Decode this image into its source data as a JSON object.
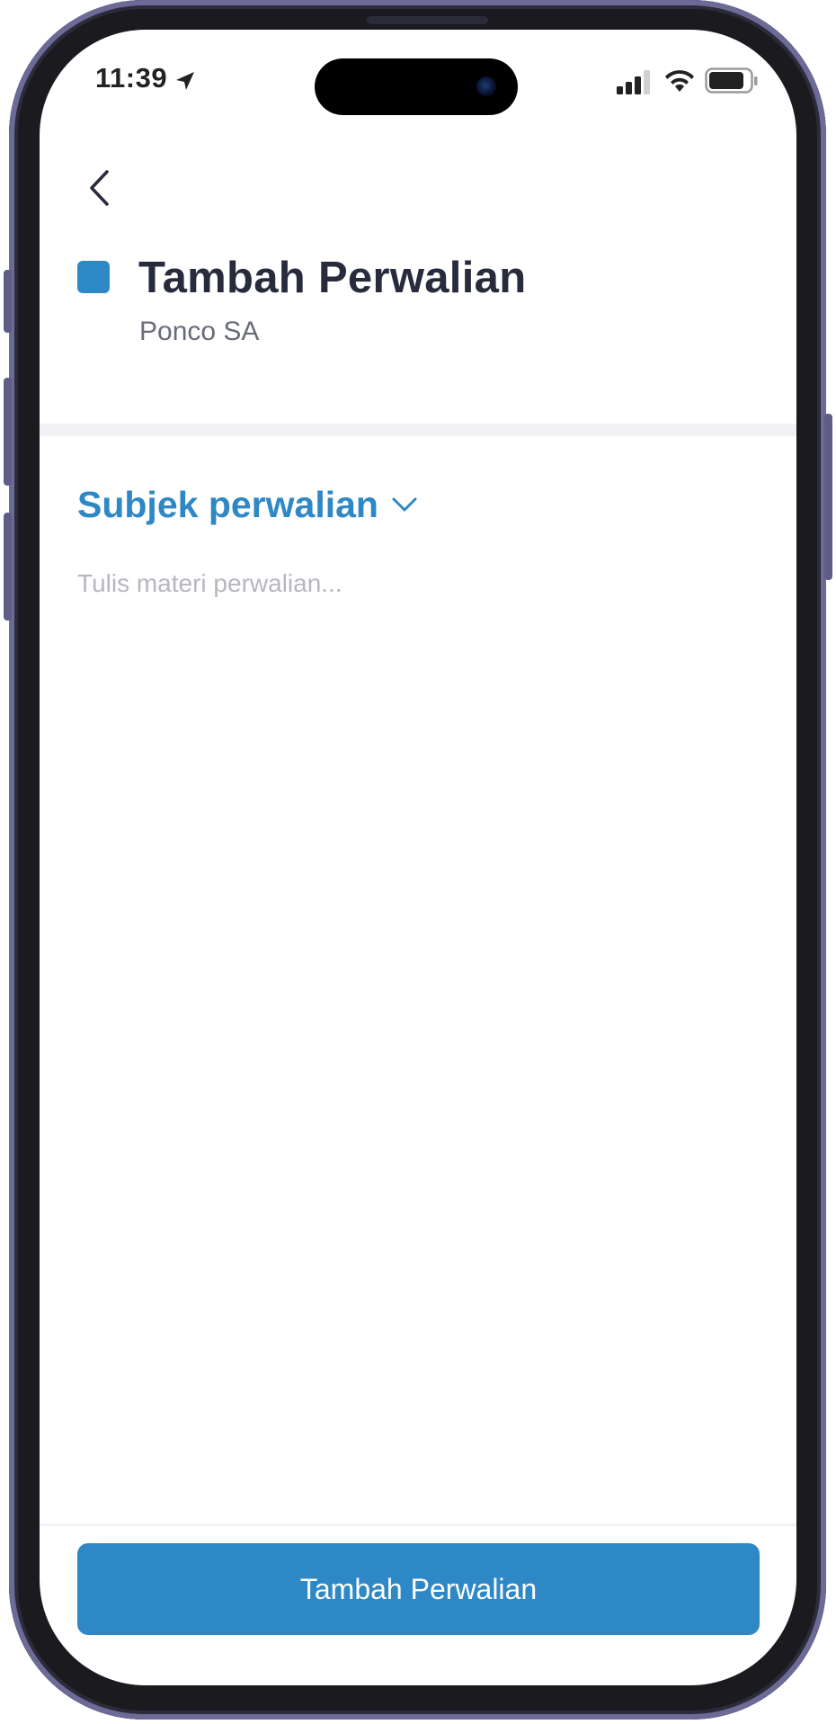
{
  "status_bar": {
    "time": "11:39",
    "location_icon": "location-arrow-icon",
    "signal_icon": "cellular-signal-icon",
    "wifi_icon": "wifi-icon",
    "battery_icon": "battery-icon"
  },
  "header": {
    "back_icon": "chevron-left-icon",
    "title": "Tambah Perwalian",
    "subtitle": "Ponco SA",
    "title_marker_color": "#2e88c6"
  },
  "form": {
    "subject_label": "Subjek perwalian",
    "subject_icon": "chevron-down-icon",
    "material_placeholder": "Tulis materi perwalian...",
    "material_value": ""
  },
  "footer": {
    "submit_label": "Tambah Perwalian"
  },
  "colors": {
    "accent": "#2e88c6",
    "title_text": "#272b3b",
    "subtitle_text": "#686c78",
    "placeholder_text": "#b6b7bf"
  }
}
